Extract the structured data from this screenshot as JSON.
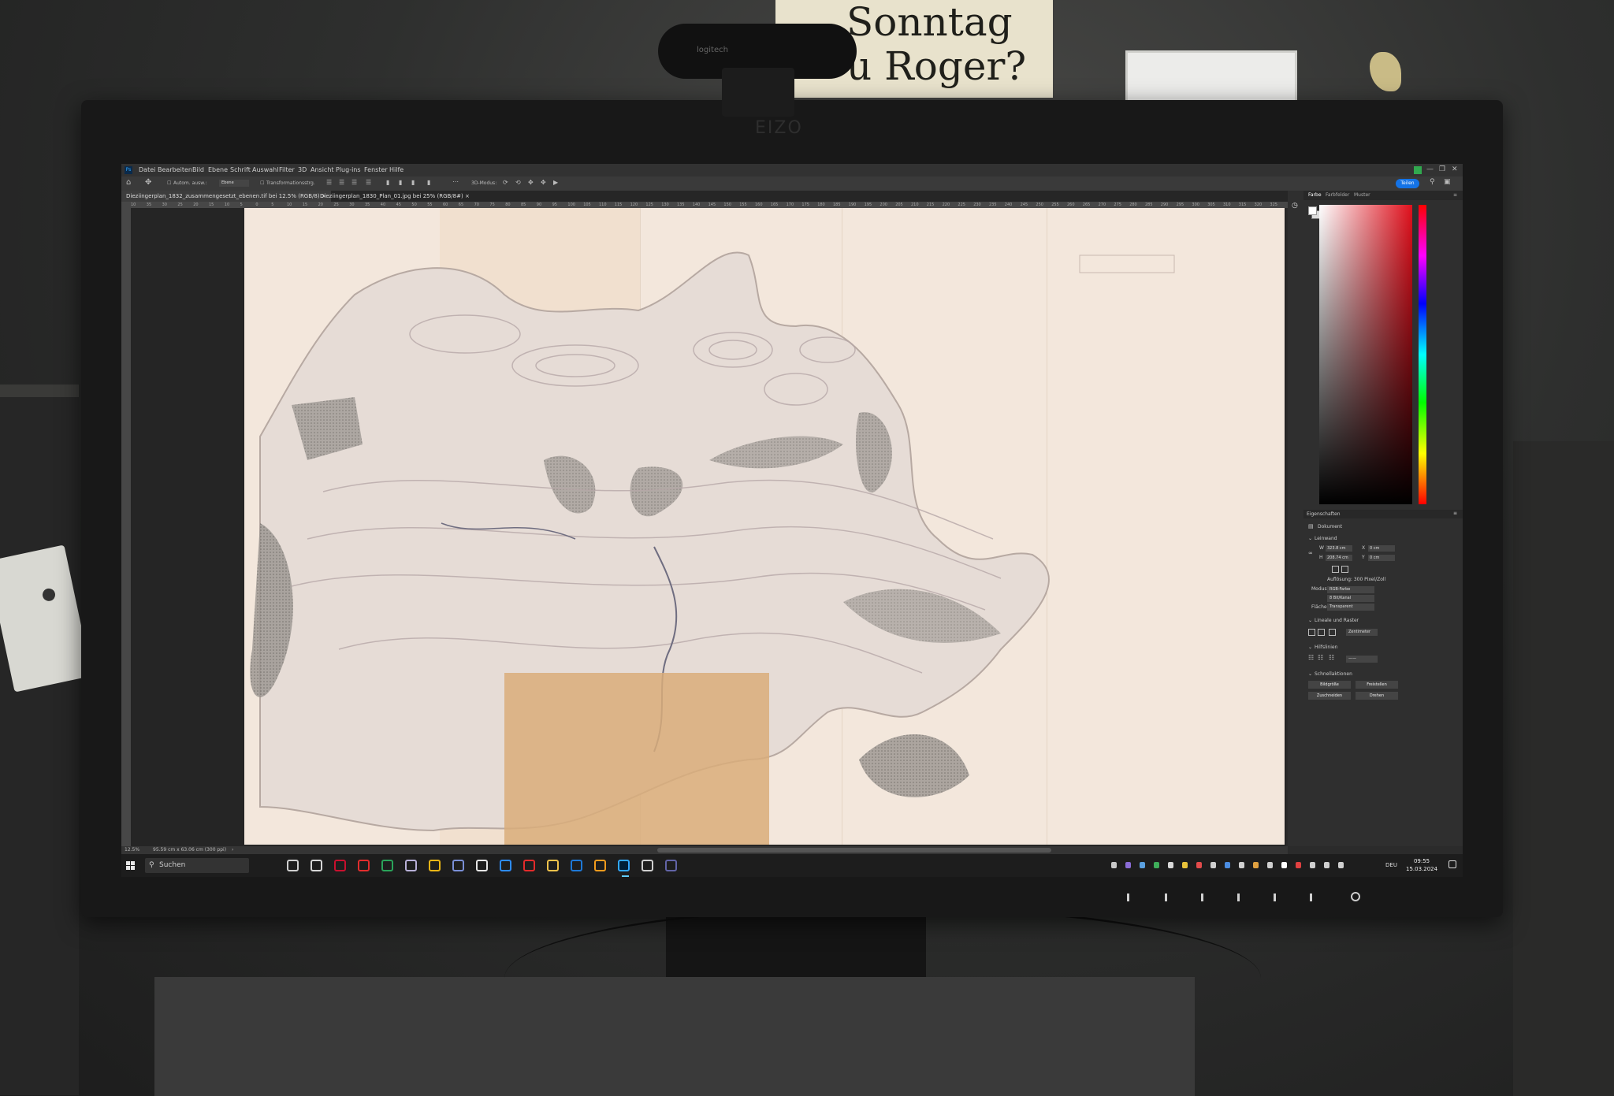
{
  "room": {
    "note_lines": [
      "Sonntag",
      "u Roger?"
    ],
    "webcam_brand": "logitech",
    "monitor_brand": "EIZO"
  },
  "photoshop": {
    "menu": [
      "Datei",
      "Bearbeiten",
      "Bild",
      "Ebene",
      "Schrift",
      "Auswahl",
      "Filter",
      "3D",
      "Ansicht",
      "Plug-ins",
      "Fenster",
      "Hilfe"
    ],
    "options": {
      "auto_select": "Autom. ausw.:",
      "layer_dropdown": "Ebene",
      "transform_controls": "Transformationsstrg.",
      "mode_3d": "3D-Modus:",
      "share_button": "Teilen"
    },
    "tabs": [
      {
        "label": "Dieziingerplan_1832_zusammengesetzt_ebenen.tif bei 12.5% (RGB/8)",
        "active": true
      },
      {
        "label": "Dieziingerplan_1830_Plan_01.jpg bei 25% (RGB/8#)",
        "active": false
      }
    ],
    "ruler_ticks": [
      "10",
      "35",
      "30",
      "25",
      "20",
      "15",
      "10",
      "5",
      "0",
      "5",
      "10",
      "15",
      "20",
      "25",
      "30",
      "35",
      "40",
      "45",
      "50",
      "55",
      "60",
      "65",
      "70",
      "75",
      "80",
      "85",
      "90",
      "95",
      "100",
      "105",
      "110",
      "115",
      "120",
      "125",
      "130",
      "135",
      "140",
      "145",
      "150",
      "155",
      "160",
      "165",
      "170",
      "175",
      "180",
      "185",
      "190",
      "195",
      "200",
      "205",
      "210",
      "215",
      "220",
      "225",
      "230",
      "235",
      "240",
      "245",
      "250",
      "255",
      "260",
      "265",
      "270",
      "275",
      "280",
      "285",
      "290",
      "295",
      "300",
      "305",
      "310",
      "315",
      "320",
      "325"
    ],
    "status": {
      "zoom": "12.5%",
      "doc_size": "95.59 cm x 63.06 cm (300 ppi)"
    },
    "panel_tabs": [
      {
        "label": "Farbe",
        "active": true
      },
      {
        "label": "Farbfelder",
        "active": false
      },
      {
        "label": "Muster",
        "active": false
      }
    ],
    "properties": {
      "title": "Eigenschaften",
      "doc_label": "Dokument",
      "canvas_section": "Leinwand",
      "w_label": "W",
      "w_value": "323.8 cm",
      "h_label": "H",
      "h_value": "208.74 cm",
      "x_label": "X",
      "x_value": "0 cm",
      "y_label": "Y",
      "y_value": "0 cm",
      "resolution": "Auflösung: 300 Pixel/Zoll",
      "mode_label": "Modus",
      "mode_value": "RGB-Farbe",
      "depth_value": "8 Bit/Kanal",
      "fill_label": "Fläche",
      "fill_value": "Transparent",
      "rulers_section": "Lineale und Raster",
      "ruler_unit": "Zentimeter",
      "guides_section": "Hilfslinien",
      "quick_section": "Schnellaktionen",
      "btn_image_size": "Bildgröße",
      "btn_free": "Freistellen",
      "btn_trim": "Zuschneiden",
      "btn_rotate": "Drehen"
    }
  },
  "taskbar": {
    "search_placeholder": "Suchen",
    "language": "DEU",
    "time": "09:55",
    "date": "15.03.2024",
    "apps": [
      {
        "icon": "task-view-icon",
        "color": "#cfcfcf"
      },
      {
        "icon": "app-doc-icon",
        "color": "#d6d6d6"
      },
      {
        "icon": "app-red-icon",
        "color": "#c8102e"
      },
      {
        "icon": "app-c-icon",
        "color": "#e22d2d"
      },
      {
        "icon": "app-green-icon",
        "color": "#2aa35a"
      },
      {
        "icon": "app-photo-icon",
        "color": "#b8b0d8"
      },
      {
        "icon": "chrome-icon",
        "color": "#e9b516"
      },
      {
        "icon": "app-lock-icon",
        "color": "#7a8fd6"
      },
      {
        "icon": "app-box-icon",
        "color": "#e6e6e6"
      },
      {
        "icon": "zoom-icon",
        "color": "#2d8cff"
      },
      {
        "icon": "acrobat-icon",
        "color": "#e32b2b"
      },
      {
        "icon": "explorer-icon",
        "color": "#f0c24b"
      },
      {
        "icon": "outlook-icon",
        "color": "#1e78d6"
      },
      {
        "icon": "vlc-icon",
        "color": "#f29b1d"
      },
      {
        "icon": "photoshop-icon",
        "color": "#31a8ff"
      },
      {
        "icon": "bridge-icon",
        "color": "#cfcfcf"
      },
      {
        "icon": "teams-icon",
        "color": "#6264a7"
      }
    ]
  }
}
